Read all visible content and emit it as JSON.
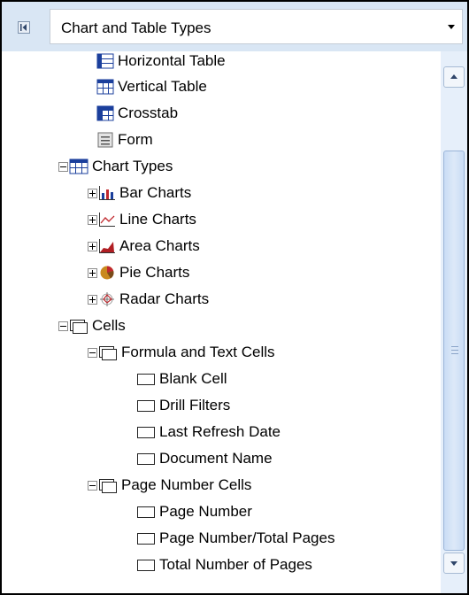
{
  "header": {
    "dropdown_value": "Chart and Table Types",
    "collapse_icon": "panel-collapse-icon",
    "dropdown_icon": "chevron-down-icon"
  },
  "tree": {
    "partial_item": "Horizontal Table",
    "table_items": [
      "Vertical Table",
      "Crosstab",
      "Form"
    ],
    "chart_types": {
      "label": "Chart Types",
      "children": [
        "Bar Charts",
        "Line Charts",
        "Area Charts",
        "Pie Charts",
        "Radar Charts"
      ]
    },
    "cells": {
      "label": "Cells",
      "formula_group": {
        "label": "Formula and Text Cells",
        "children": [
          "Blank Cell",
          "Drill Filters",
          "Last Refresh Date",
          "Document Name"
        ]
      },
      "page_group": {
        "label": "Page Number Cells",
        "children": [
          "Page Number",
          "Page Number/Total Pages",
          "Total Number of Pages"
        ]
      }
    }
  },
  "colors": {
    "header_bg": "#d9e6f4",
    "table_icon_blue": "#1b3f9c",
    "scrollbar_bg": "#e6effa"
  }
}
